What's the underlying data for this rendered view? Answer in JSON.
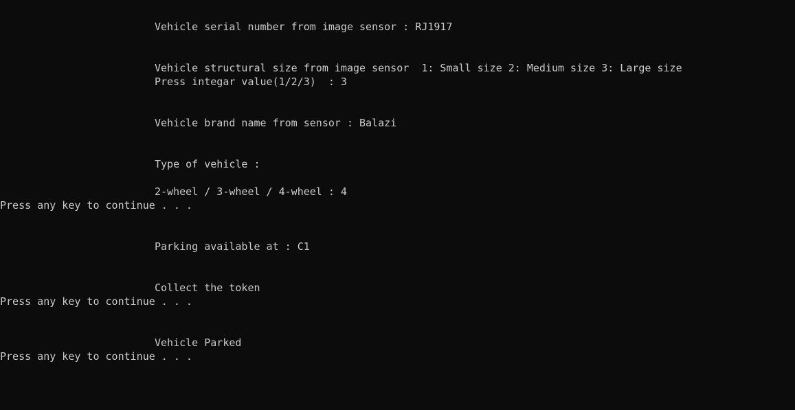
{
  "console": {
    "lines": [
      {
        "text": "Vehicle serial number from image sensor : RJ1917"
      },
      {
        "text": "Vehicle structural size from image sensor  1: Small size 2: Medium size 3: Large size"
      },
      {
        "text": "Press integar value(1/2/3)  : 3"
      },
      {
        "text": "Vehicle brand name from sensor : Balazi"
      },
      {
        "text": "Type of vehicle :"
      },
      {
        "text": "2-wheel / 3-wheel / 4-wheel : 4"
      },
      {
        "text": "Press any key to continue . . ."
      },
      {
        "text": "Parking available at : C1"
      },
      {
        "text": "Collect the token"
      },
      {
        "text": "Press any key to continue . . ."
      },
      {
        "text": "Vehicle Parked"
      },
      {
        "text": "Press any key to continue . . ."
      }
    ]
  },
  "colors": {
    "background": "#0c0c0c",
    "foreground": "#cccccc"
  }
}
